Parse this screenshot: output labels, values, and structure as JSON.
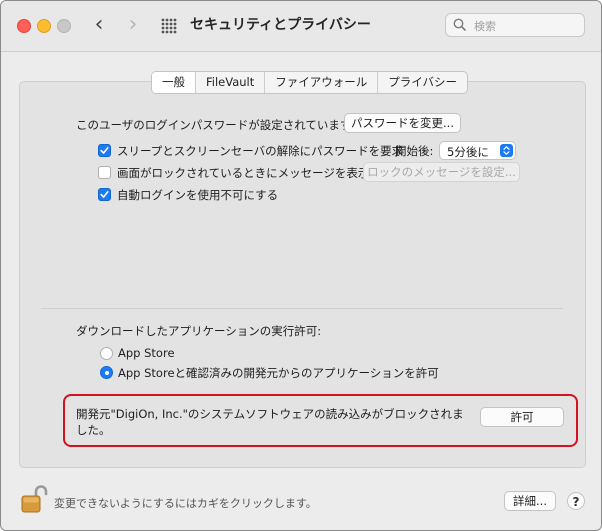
{
  "window": {
    "title": "セキュリティとプライバシー"
  },
  "search": {
    "placeholder": "検索"
  },
  "tabs": [
    {
      "label": "一般",
      "active": true
    },
    {
      "label": "FileVault",
      "active": false
    },
    {
      "label": "ファイアウォール",
      "active": false
    },
    {
      "label": "プライバシー",
      "active": false
    }
  ],
  "general": {
    "password_status": "このユーザのログインパスワードが設定されています",
    "change_password_button": "パスワードを変更...",
    "require_password_label": "スリープとスクリーンセーバの解除にパスワードを要求",
    "require_password_checked": true,
    "start_after_label": "開始後:",
    "start_after_value": "5分後に",
    "lock_message_label": "画面がロックされているときにメッセージを表示",
    "lock_message_checked": false,
    "lock_message_button": "ロックのメッセージを設定...",
    "disable_auto_login_label": "自動ログインを使用不可にする",
    "disable_auto_login_checked": true
  },
  "downloads": {
    "heading": "ダウンロードしたアプリケーションの実行許可:",
    "options": [
      {
        "label": "App Store",
        "selected": false
      },
      {
        "label": "App Storeと確認済みの開発元からのアプリケーションを許可",
        "selected": true
      }
    ],
    "blocked_message": "開発元\"DigiOn, Inc.\"のシステムソフトウェアの読み込みがブロックされました。",
    "allow_button": "許可"
  },
  "footer": {
    "lock_text": "変更できないようにするにはカギをクリックします。",
    "advanced_button": "詳細...",
    "help_button": "?"
  },
  "colors": {
    "accent": "#1a7cf4",
    "highlight": "#d4121f"
  }
}
